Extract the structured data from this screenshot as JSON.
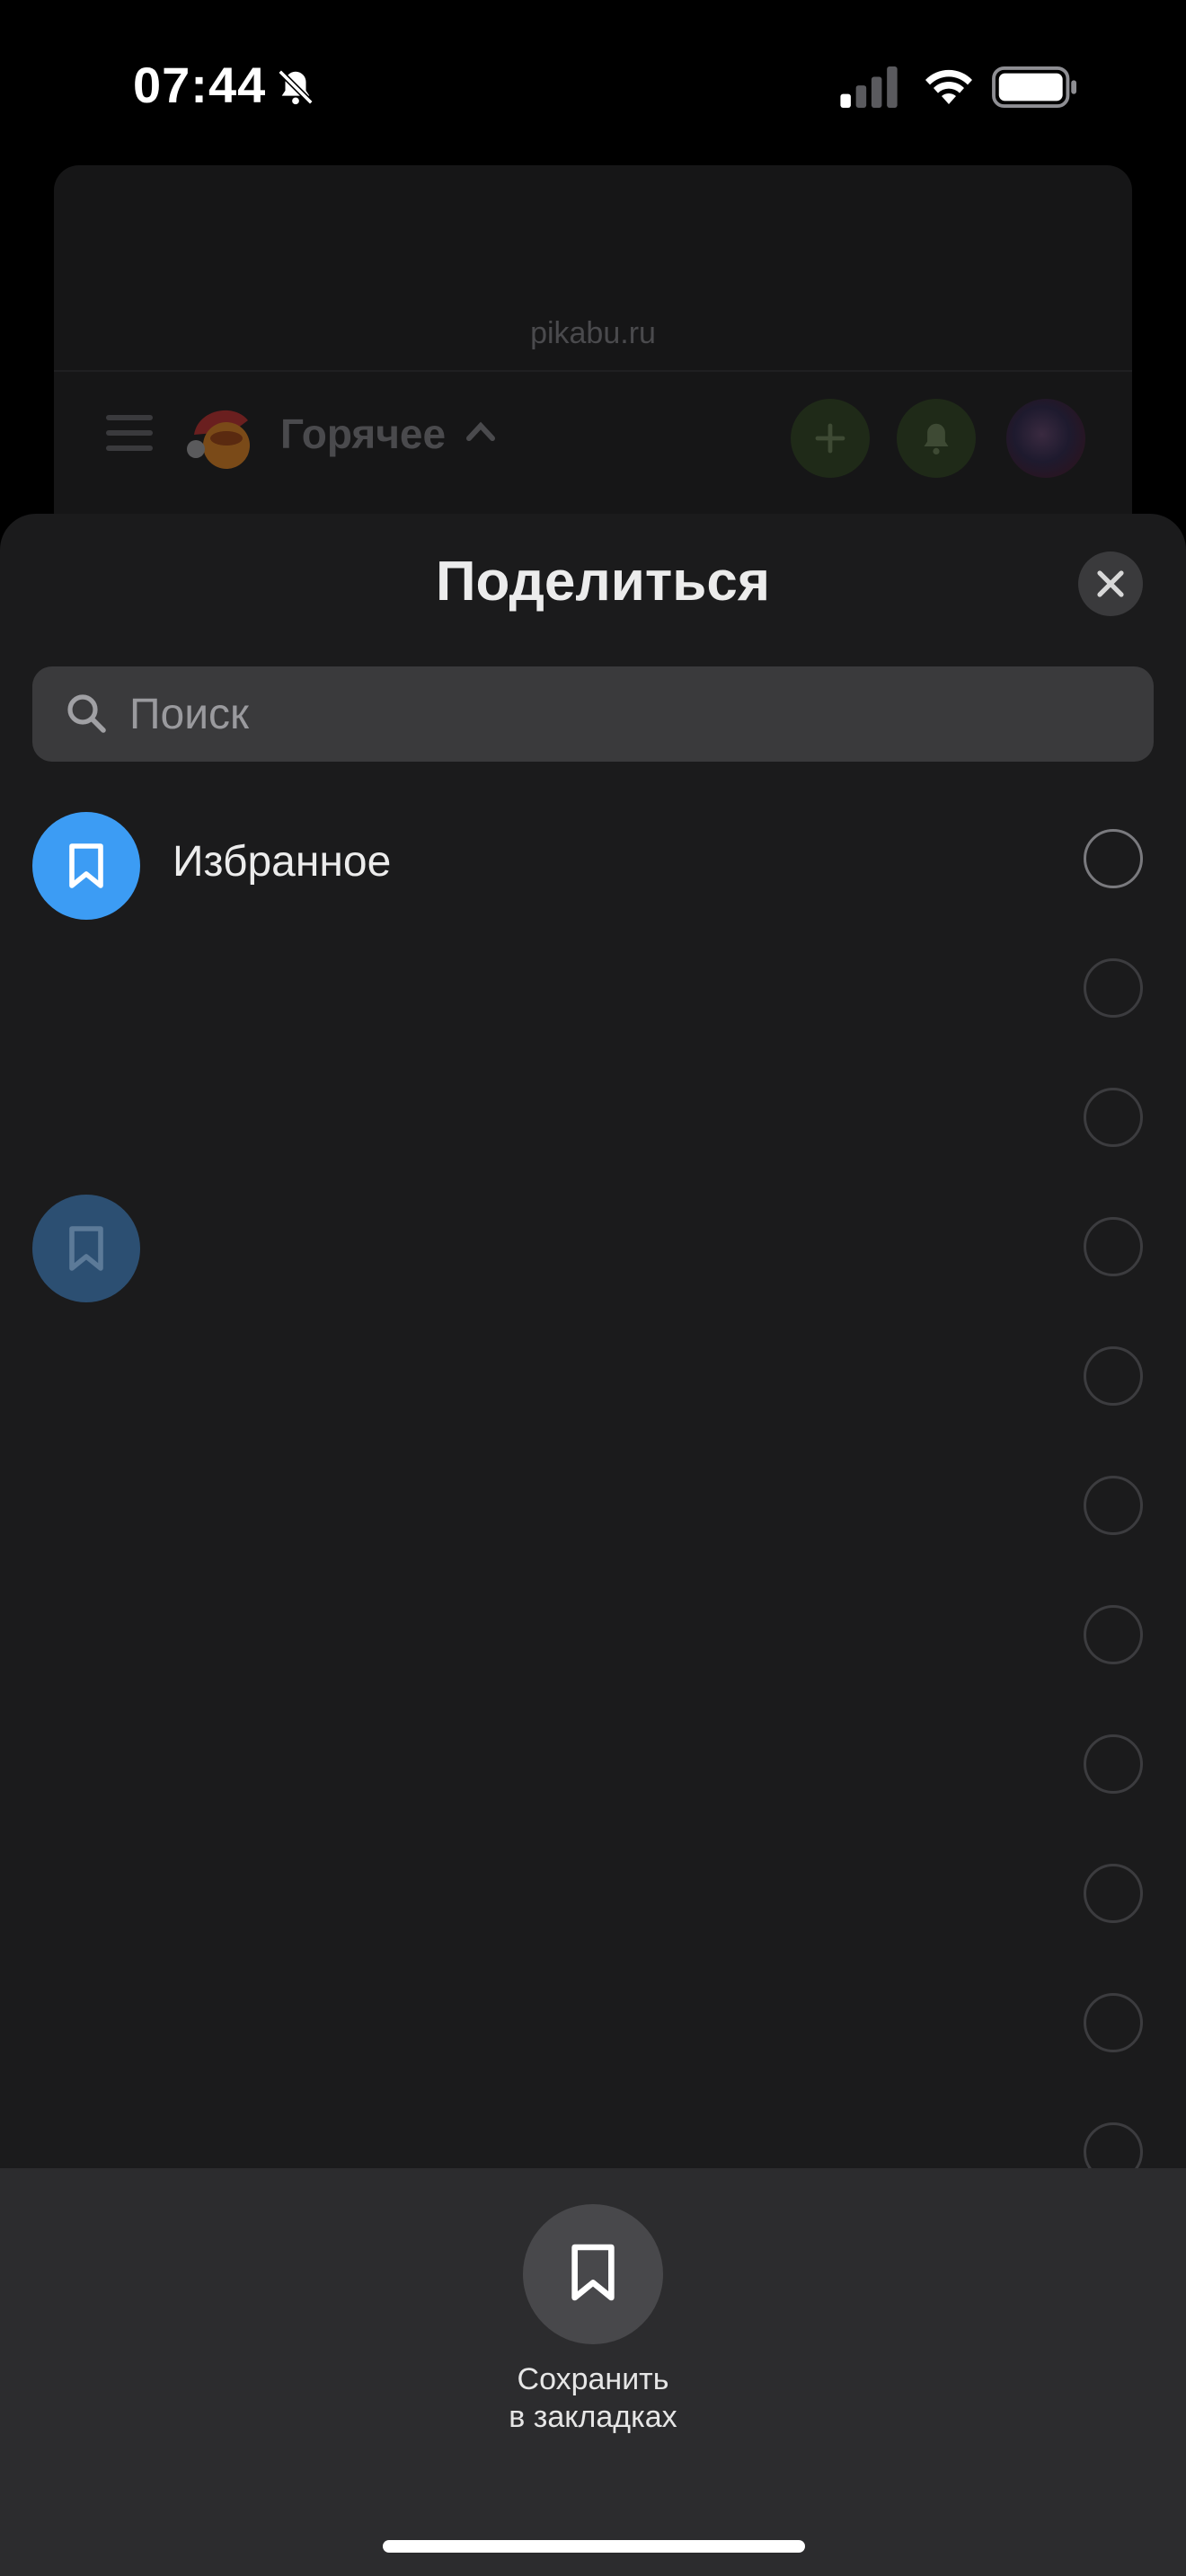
{
  "status_bar": {
    "time": "07:44",
    "icons": [
      "bell-slash-icon",
      "cellular-signal-icon",
      "wifi-icon",
      "battery-icon"
    ]
  },
  "background_page": {
    "url": "pikabu.ru",
    "title": "Горячее",
    "icons": [
      "menu-icon",
      "santa-logo",
      "chevron-up-icon",
      "plus-icon",
      "bell-icon",
      "avatar"
    ]
  },
  "share_sheet": {
    "title": "Поделиться",
    "close_icon": "close-icon",
    "search": {
      "placeholder": "Поиск",
      "value": ""
    },
    "items": [
      {
        "label": "Избранное",
        "icon": "bookmark-icon"
      }
    ],
    "action": {
      "label": "Сохранить\nв закладках",
      "icon": "bookmark-icon"
    }
  },
  "colors": {
    "sheet_background": "#1b1b1c",
    "accent_blue": "#3c9cf4",
    "action_bar": "#2c2c2e"
  }
}
